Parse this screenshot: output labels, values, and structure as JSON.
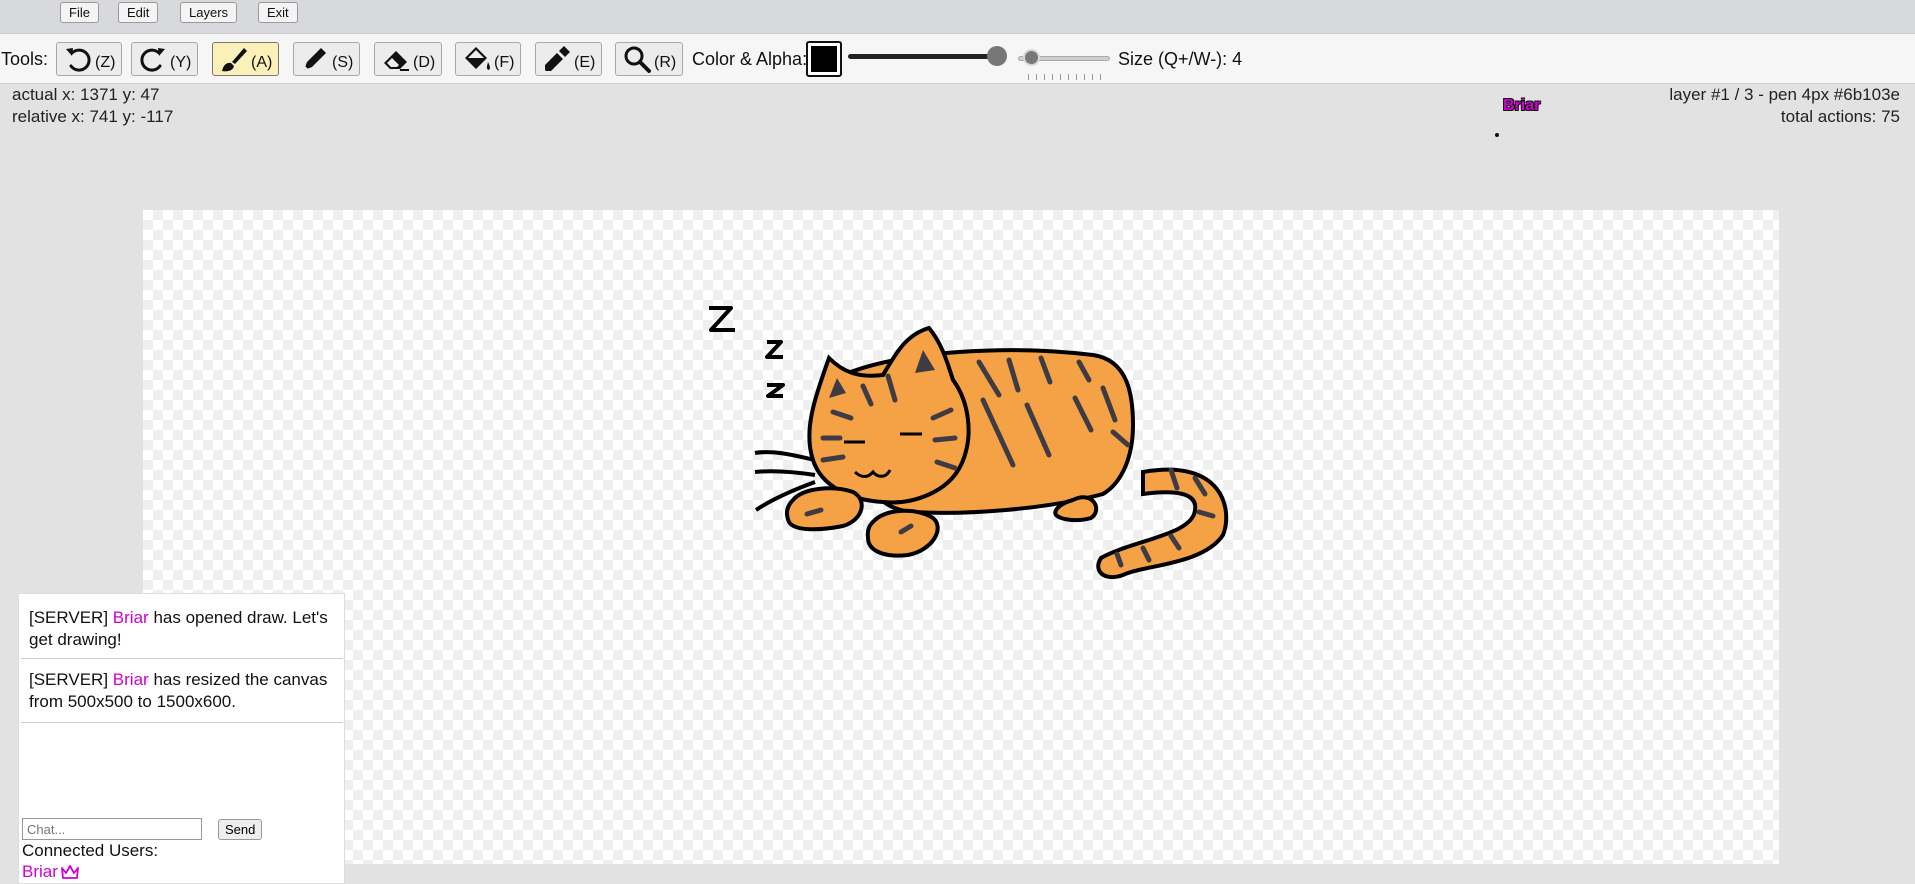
{
  "menu": {
    "file": "File",
    "edit": "Edit",
    "layers": "Layers",
    "exit": "Exit"
  },
  "toolbar": {
    "tools_label": "Tools:",
    "tools": [
      {
        "name": "undo",
        "icon": "undo-icon",
        "key": "(Z)",
        "active": false
      },
      {
        "name": "redo",
        "icon": "redo-icon",
        "key": "(Y)",
        "active": false
      },
      {
        "name": "brush",
        "icon": "brush-icon",
        "key": "(A)",
        "active": true
      },
      {
        "name": "pen",
        "icon": "pen-icon",
        "key": "(S)",
        "active": false
      },
      {
        "name": "eraser",
        "icon": "eraser-icon",
        "key": "(D)",
        "active": false
      },
      {
        "name": "fill",
        "icon": "paint-bucket-icon",
        "key": "(F)",
        "active": false
      },
      {
        "name": "eyedropper",
        "icon": "eyedropper-icon",
        "key": "(E)",
        "active": false
      },
      {
        "name": "zoom",
        "icon": "magnifier-icon",
        "key": "(R)",
        "active": false
      }
    ],
    "color_label": "Color & Alpha:",
    "color": "#000000",
    "alpha_percent": 100,
    "size_label": "Size (Q+/W-): 4"
  },
  "info": {
    "actual": "actual x: 1371 y: 47",
    "relative": "relative x: 741 y: -117",
    "layer": "layer #1 / 3 - pen 4px #6b103e",
    "actions": "total actions: 75"
  },
  "cursor": {
    "user": "Briar",
    "color": "#d000d0"
  },
  "canvas": {
    "drawing": "sleeping-cat-drawing",
    "colors": {
      "fur": "#f5a246",
      "stripes": "#3d3b44",
      "outline": "#000000"
    }
  },
  "chat": {
    "messages": [
      {
        "prefix": "[SERVER]",
        "user": "Briar",
        "text": "has opened draw. Let's get drawing!"
      },
      {
        "prefix": "[SERVER]",
        "user": "Briar",
        "text": "has resized the canvas from 500x500 to 1500x600."
      }
    ],
    "input_placeholder": "Chat...",
    "send_label": "Send",
    "users_label": "Connected Users:",
    "users": [
      {
        "name": "Briar",
        "badge": "crown-icon"
      }
    ]
  }
}
